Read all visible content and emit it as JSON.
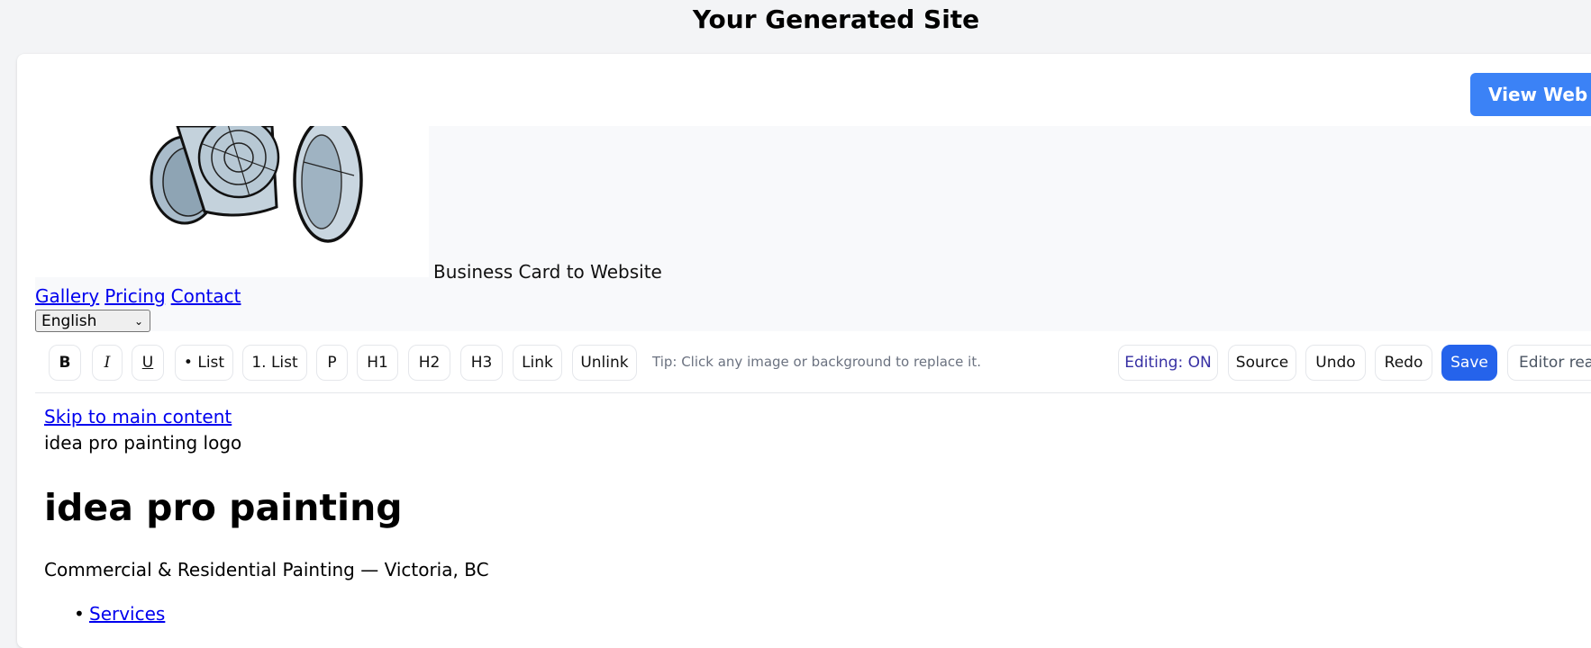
{
  "page": {
    "title": "Your Generated Site"
  },
  "header": {
    "view_button": "View Web Page",
    "tagline": "Business Card to Website",
    "nav": [
      "Gallery",
      "Pricing",
      "Contact"
    ],
    "language": "English"
  },
  "toolbar": {
    "bold": "B",
    "italic": "I",
    "underline": "U",
    "bullet_list": "• List",
    "numbered_list": "1. List",
    "paragraph": "P",
    "h1": "H1",
    "h2": "H2",
    "h3": "H3",
    "link": "Link",
    "unlink": "Unlink",
    "tip": "Tip: Click any image or background to replace it.",
    "editing": "Editing: ON",
    "source": "Source",
    "undo": "Undo",
    "redo": "Redo",
    "save": "Save",
    "status": "Editor ready"
  },
  "site": {
    "skip_link": "Skip to main content",
    "logo_alt": "idea pro painting logo",
    "heading": "idea pro painting",
    "subheading": "Commercial & Residential Painting — Victoria, BC",
    "nav_items": [
      "Services"
    ]
  },
  "colors": {
    "accent": "#3b82f6",
    "save": "#2563eb",
    "link": "#0000ee"
  }
}
